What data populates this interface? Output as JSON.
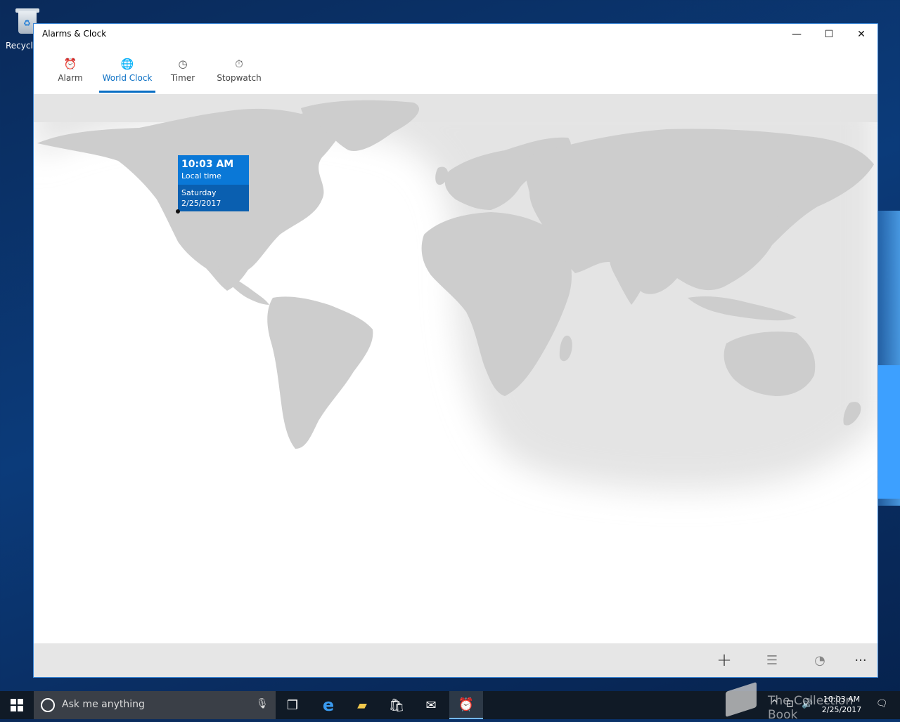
{
  "desktop": {
    "recycle_bin_label": "Recycle"
  },
  "window": {
    "title": "Alarms & Clock",
    "controls": {
      "minimize": "—",
      "maximize": "☐",
      "close": "✕"
    }
  },
  "tabs": [
    {
      "label": "Alarm",
      "icon": "alarm-clock-icon",
      "active": false
    },
    {
      "label": "World Clock",
      "icon": "globe-clock-icon",
      "active": true
    },
    {
      "label": "Timer",
      "icon": "timer-icon",
      "active": false
    },
    {
      "label": "Stopwatch",
      "icon": "stopwatch-icon",
      "active": false
    }
  ],
  "location": {
    "time": "10:03 AM",
    "label": "Local time",
    "day": "Saturday",
    "date": "2/25/2017"
  },
  "command_bar": {
    "icons": [
      "add-icon",
      "select-list-icon",
      "compare-icon",
      "more-icon"
    ]
  },
  "taskbar": {
    "search_placeholder": "Ask me anything",
    "clock_time": "10:03 AM",
    "clock_date": "2/25/2017"
  },
  "watermark": {
    "text": "The Collection Book"
  },
  "colors": {
    "accent": "#0a78d7",
    "accent_dark": "#0a5fb0",
    "land": "#cfcfcf",
    "night": "#e6e6e6"
  }
}
